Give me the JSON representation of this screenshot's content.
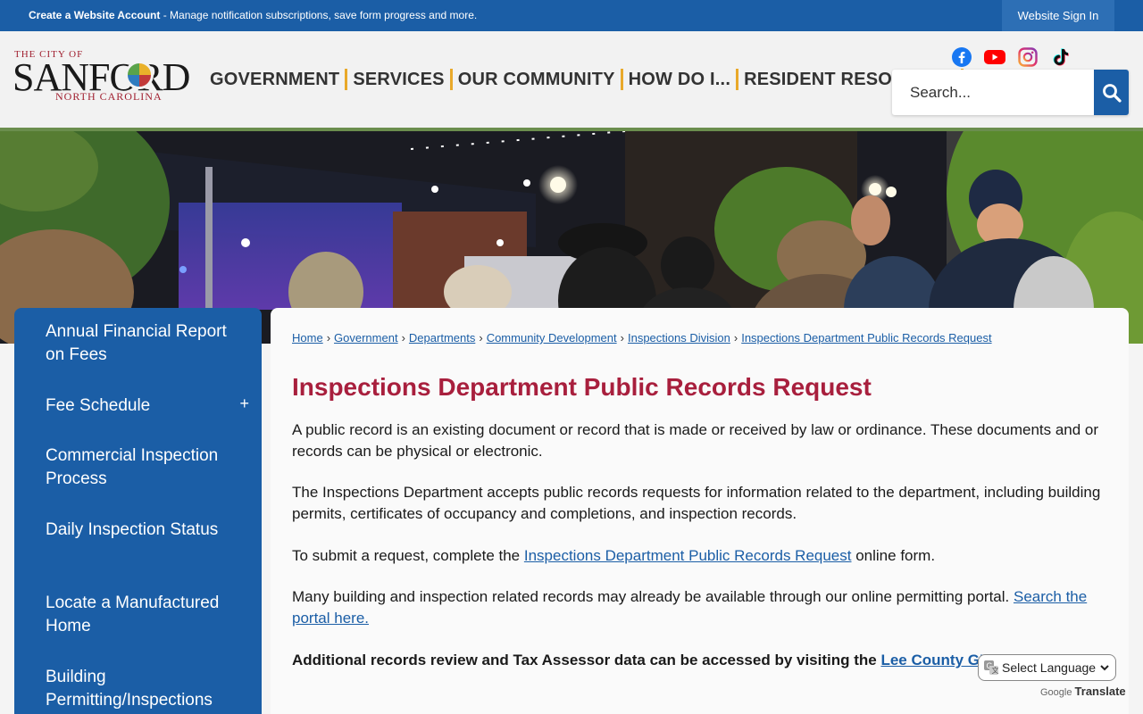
{
  "topbar": {
    "account_link": "Create a Website Account",
    "account_desc": " - Manage notification subscriptions, save form progress and more.",
    "signin": "Website Sign In"
  },
  "logo": {
    "top": "THE CITY OF",
    "name": "SANFORD",
    "state": "NORTH CAROLINA"
  },
  "nav": [
    "GOVERNMENT",
    "SERVICES",
    "OUR COMMUNITY",
    "HOW DO I...",
    "RESIDENT RESOURCES"
  ],
  "social": [
    "facebook-icon",
    "youtube-icon",
    "instagram-icon",
    "tiktok-icon"
  ],
  "search": {
    "placeholder": "Search..."
  },
  "sidebar": {
    "items": [
      "Annual Financial Report on Fees",
      "Fee Schedule",
      "Commercial Inspection Process",
      "Daily Inspection Status",
      "Locate a Manufactured Home",
      "Building Permitting/Inspections"
    ],
    "toggle": "+"
  },
  "breadcrumb": [
    "Home",
    "Government",
    "Departments",
    "Community Development",
    "Inspections Division",
    "Inspections Department Public Records Request"
  ],
  "breadcrumb_sep": "›",
  "page": {
    "title": "Inspections Department Public Records Request",
    "p1": "A public record is an existing document or record that is made or received by law or ordinance.  These documents and or records can be physical or electronic.",
    "p2": "The Inspections Department accepts public records requests for information related to the department, including building permits, certificates of occupancy and completions, and inspection records.",
    "p3_before": "To submit a request, complete the ",
    "p3_link": "Inspections Department Public Records Request",
    "p3_after": " online form.",
    "p4_before": "Many building and inspection related records may already be available through our online permitting portal. ",
    "p4_link": "Search the portal here.",
    "p5_before": "Additional records review and Tax Assessor data can be accessed by visiting the ",
    "p5_link": "Lee County GIS w"
  },
  "translate": {
    "select": "Select Language",
    "powered_by": "Google",
    "translate": "Translate"
  },
  "colors": {
    "brand_blue": "#1b5ea6",
    "title_red": "#a81f3d",
    "nav_separator": "#e9a92a"
  }
}
